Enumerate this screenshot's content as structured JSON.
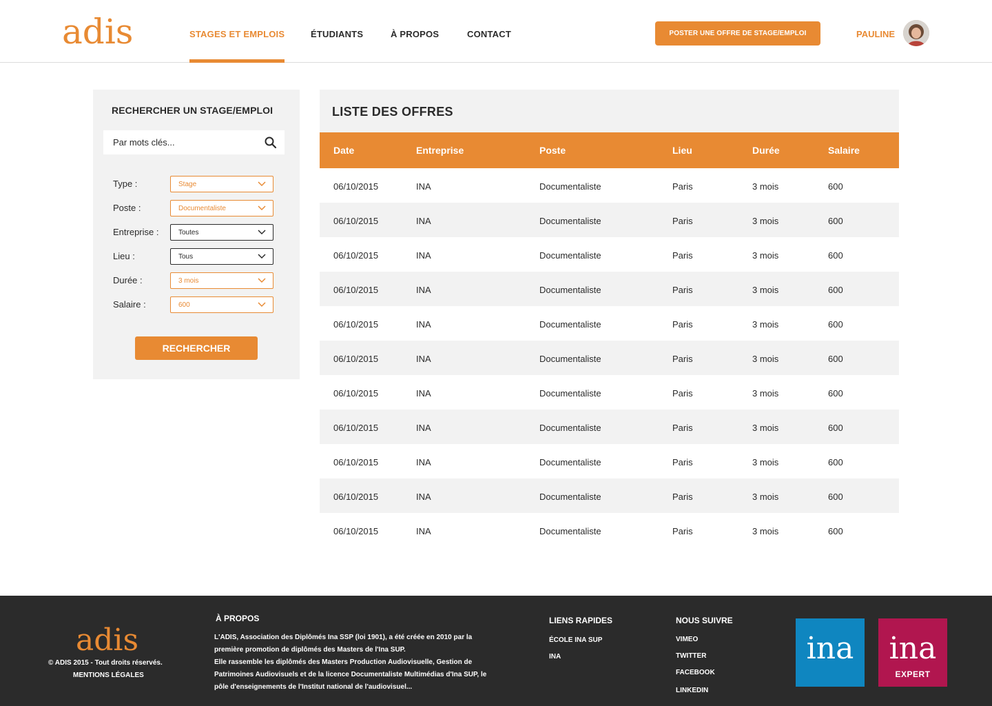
{
  "header": {
    "logo": "adis",
    "nav": [
      {
        "label": "STAGES ET EMPLOIS",
        "active": true
      },
      {
        "label": "ÉTUDIANTS",
        "active": false
      },
      {
        "label": "À PROPOS",
        "active": false
      },
      {
        "label": "CONTACT",
        "active": false
      }
    ],
    "post_button": "POSTER UNE OFFRE DE STAGE/EMPLOI",
    "user_name": "PAULINE",
    "accent_color": "#e88a33"
  },
  "sidebar": {
    "title": "RECHERCHER UN STAGE/EMPLOI",
    "search_placeholder": "Par mots clés...",
    "filters": [
      {
        "label": "Type :",
        "value": "Stage",
        "highlighted": true
      },
      {
        "label": "Poste :",
        "value": "Documentaliste",
        "highlighted": true
      },
      {
        "label": "Entreprise :",
        "value": "Toutes",
        "highlighted": false
      },
      {
        "label": "Lieu :",
        "value": "Tous",
        "highlighted": false
      },
      {
        "label": "Durée :",
        "value": "3 mois",
        "highlighted": true
      },
      {
        "label": "Salaire :",
        "value": "600",
        "highlighted": true
      }
    ],
    "search_button": "RECHERCHER"
  },
  "list": {
    "title": "LISTE DES OFFRES",
    "columns": [
      "Date",
      "Entreprise",
      "Poste",
      "Lieu",
      "Durée",
      "Salaire"
    ],
    "rows": [
      [
        "06/10/2015",
        "INA",
        "Documentaliste",
        "Paris",
        "3 mois",
        "600"
      ],
      [
        "06/10/2015",
        "INA",
        "Documentaliste",
        "Paris",
        "3 mois",
        "600"
      ],
      [
        "06/10/2015",
        "INA",
        "Documentaliste",
        "Paris",
        "3 mois",
        "600"
      ],
      [
        "06/10/2015",
        "INA",
        "Documentaliste",
        "Paris",
        "3 mois",
        "600"
      ],
      [
        "06/10/2015",
        "INA",
        "Documentaliste",
        "Paris",
        "3 mois",
        "600"
      ],
      [
        "06/10/2015",
        "INA",
        "Documentaliste",
        "Paris",
        "3 mois",
        "600"
      ],
      [
        "06/10/2015",
        "INA",
        "Documentaliste",
        "Paris",
        "3 mois",
        "600"
      ],
      [
        "06/10/2015",
        "INA",
        "Documentaliste",
        "Paris",
        "3 mois",
        "600"
      ],
      [
        "06/10/2015",
        "INA",
        "Documentaliste",
        "Paris",
        "3 mois",
        "600"
      ],
      [
        "06/10/2015",
        "INA",
        "Documentaliste",
        "Paris",
        "3 mois",
        "600"
      ],
      [
        "06/10/2015",
        "INA",
        "Documentaliste",
        "Paris",
        "3 mois",
        "600"
      ]
    ]
  },
  "footer": {
    "logo": "adis",
    "copyright": "© ADIS 2015 - Tout droits réservés.",
    "legal": "MENTIONS LÉGALES",
    "about_title": "À PROPOS",
    "about_text_1": "L'ADIS, Association des Diplômés Ina SSP (loi 1901), a été créée en 2010 par la première promotion de diplômés des Masters de l'Ina SUP.",
    "about_text_2": "Elle rassemble les diplômés des Masters Production Audiovisuelle, Gestion de Patrimoines Audiovisuels et de la licence Documentaliste Multimédias d'Ina SUP, le pôle d'enseignements de l'Institut national de l'audiovisuel...",
    "quick_links_title": "LIENS RAPIDES",
    "quick_links": [
      "ÉCOLE INA SUP",
      "INA"
    ],
    "follow_title": "NOUS SUIVRE",
    "follow_links": [
      "VIMEO",
      "TWITTER",
      "FACEBOOK",
      "LINKEDIN"
    ],
    "ina_logo": "ina",
    "ina_expert_logo": "ina",
    "ina_expert_sub": "EXPERT",
    "ina_color": "#0f86c0",
    "ina_expert_color": "#b1164f"
  }
}
